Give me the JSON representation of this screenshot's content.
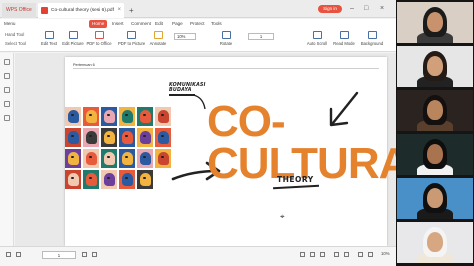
{
  "window": {
    "app_tab_label": "WPS Office",
    "document_tab_label": "Co-cultural theory (sesi 6).pdf",
    "sign_in_label": "Sign in"
  },
  "menu": {
    "items": [
      "Menu",
      "Home",
      "Insert",
      "Comment",
      "Edit",
      "Page",
      "Protect",
      "Tools"
    ],
    "active": "Home"
  },
  "toolbar": {
    "hand_tool": "Hand Tool",
    "select_tool": "Select Tool",
    "buttons": [
      "Edit Text",
      "Edit Picture",
      "PDF to Office",
      "PDF to Picture",
      "Annotate",
      "Rotate",
      "Auto Scroll",
      "Read Mode",
      "Background"
    ],
    "zoom_value": "10%",
    "page_indicator": "1"
  },
  "document": {
    "page_header": "Pertemuan 6",
    "komunikasi_line1": "KOMUNIKASI",
    "komunikasi_line2": "BUDAYA",
    "title_line1": "CO-",
    "title_line2": "CULTURAL",
    "subtitle": "THEORY"
  },
  "statusbar": {
    "page_field": "1",
    "zoom_label": "10%"
  },
  "colors": {
    "accent": "#e8533f",
    "title_orange": "#e5822d",
    "ink": "#222222"
  },
  "gallery": {
    "participant_count": 6
  }
}
